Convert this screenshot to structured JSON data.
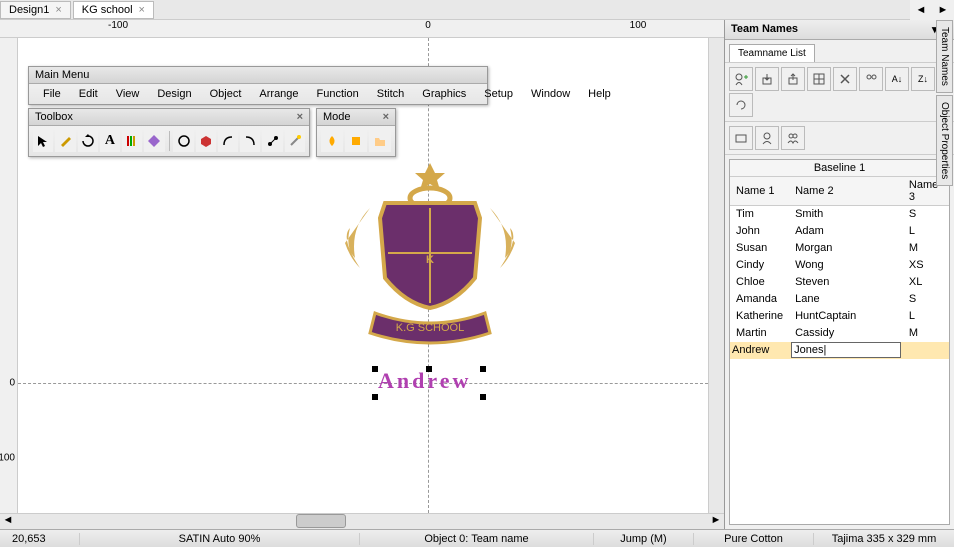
{
  "tabs": [
    {
      "label": "Design1",
      "active": false
    },
    {
      "label": "KG school",
      "active": true
    }
  ],
  "mainMenu": {
    "title": "Main Menu",
    "items": [
      "File",
      "Edit",
      "View",
      "Design",
      "Object",
      "Arrange",
      "Function",
      "Stitch",
      "Graphics",
      "Setup",
      "Window",
      "Help"
    ]
  },
  "toolbox": {
    "title": "Toolbox"
  },
  "modePanel": {
    "title": "Mode"
  },
  "ruler": {
    "ticks": [
      "-100",
      "0",
      "100"
    ]
  },
  "crest": {
    "banner": "K.G SCHOOL"
  },
  "canvasName": "Andrew",
  "sidePanel": {
    "title": "Team Names",
    "tab": "Teamname List",
    "baseline": "Baseline 1",
    "columns": [
      "Name 1",
      "Name 2",
      "Name 3"
    ],
    "rows": [
      {
        "n1": "Tim",
        "n2": "Smith",
        "n3": "S"
      },
      {
        "n1": "John",
        "n2": "Adam",
        "n3": "L"
      },
      {
        "n1": "Susan",
        "n2": "Morgan",
        "n3": "M"
      },
      {
        "n1": "Cindy",
        "n2": "Wong",
        "n3": "XS"
      },
      {
        "n1": "Chloe",
        "n2": "Steven",
        "n3": "XL"
      },
      {
        "n1": "Amanda",
        "n2": "Lane",
        "n3": "S"
      },
      {
        "n1": "Katherine",
        "n2": "HuntCaptain",
        "n3": "L"
      },
      {
        "n1": "Martin",
        "n2": "Cassidy",
        "n3": "M"
      }
    ],
    "editingRow": {
      "n1": "Andrew",
      "n2": "Jones",
      "n3": ""
    }
  },
  "verticalTabs": [
    "Team Names",
    "Object Properties"
  ],
  "status": {
    "coord": "20,653",
    "stitch": "SATIN Auto 90%",
    "object": "Object 0: Team name",
    "jump": "Jump (M)",
    "fabric": "Pure Cotton",
    "size": "Tajima 335 x 329 mm"
  }
}
